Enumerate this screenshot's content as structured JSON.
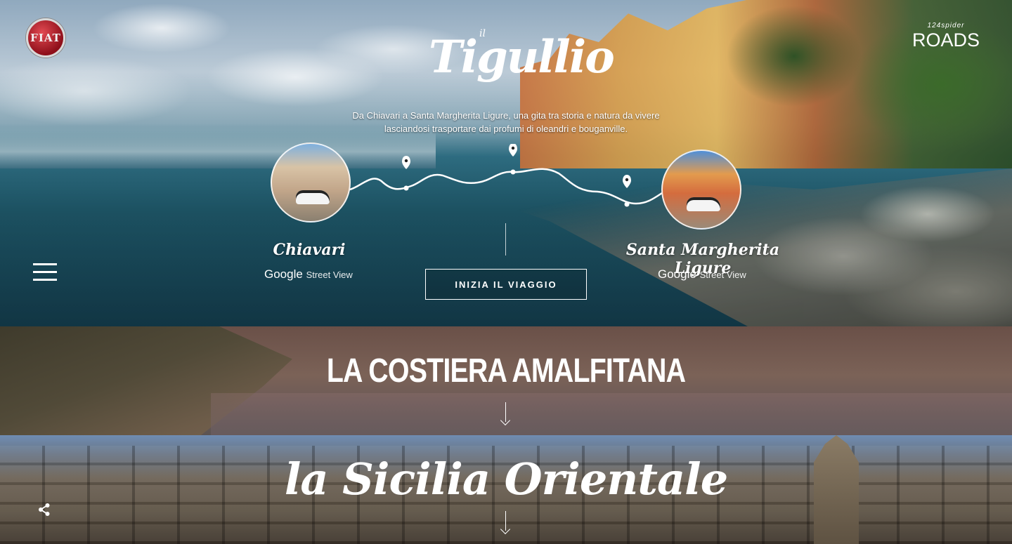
{
  "brand": {
    "fiat_logo": "FIAT",
    "roads_logo_top": "124",
    "roads_logo_sub": "spider",
    "roads_logo_main": "ROADS"
  },
  "hero": {
    "title_prefix": "il",
    "title": "Tigullio",
    "description_line1": "Da Chiavari a Santa Margherita Ligure, una gita tra storia e natura da vivere",
    "description_line2": "lasciandosi trasportare dai profumi di oleandri e bouganville.",
    "start_place": "Chiavari",
    "end_place": "Santa Margherita Ligure",
    "streetview_brand": "Google",
    "streetview_label": "Street View",
    "cta_label": "INIZIA IL VIAGGIO"
  },
  "routes": [
    {
      "title": "LA COSTIERA AMALFITANA"
    },
    {
      "title": "la Sicilia Orientale"
    }
  ],
  "icons": {
    "menu": "hamburger-menu-icon",
    "share": "share-icon",
    "pin": "map-pin-icon",
    "arrow": "arrow-down-icon"
  },
  "colors": {
    "fiat_red": "#b01c28",
    "text": "#ffffff"
  }
}
